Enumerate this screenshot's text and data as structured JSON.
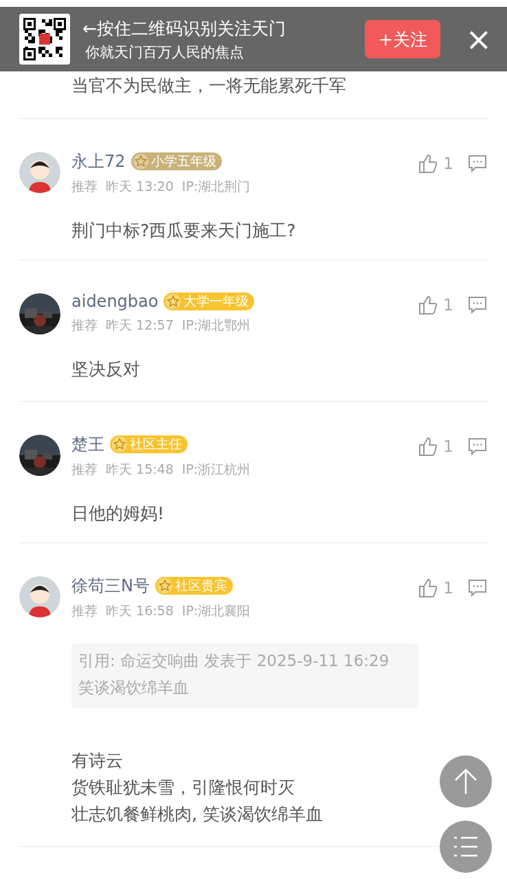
{
  "banner": {
    "title": "←按住二维码识别关注天门",
    "subtitle": "你就天门百万人民的焦点",
    "follow_label": "+关注",
    "close_label": "×"
  },
  "comments": [
    {
      "kind": "partial",
      "body": "当官不为民做主，一将无能累死千军"
    },
    {
      "kind": "full",
      "avatar": {
        "kind": "cartoon"
      },
      "name": "永上72",
      "badge": "小学五年级",
      "color": "#c9b27a",
      "source": "推荐",
      "time": "昨天 13:20",
      "ip": "IP:湖北荆门",
      "likes": "1",
      "body": "荆门中标?西瓜要来天门施工?"
    },
    {
      "kind": "full",
      "name": "aidengbao",
      "badge": "大学一年级",
      "color": "#f7c430",
      "source": "推荐",
      "time": "昨天 12:57",
      "ip": "IP:湖北鄂州",
      "likes": "1",
      "body": "坚决反对"
    },
    {
      "kind": "full",
      "name": "楚王",
      "badge": "社区主任",
      "color": "#f7c430",
      "source": "推荐",
      "time": "昨天 15:48",
      "ip": "IP:浙江杭州",
      "likes": "1",
      "body": "日他的姆妈!"
    },
    {
      "kind": "full",
      "avatar": {
        "kind": "cartoon"
      },
      "name": "徐苟三N号",
      "badge": "社区贵宾",
      "color": "#f7c430",
      "source": "推荐",
      "time": "昨天 16:58",
      "ip": "IP:湖北襄阳",
      "likes": "1",
      "quote": {
        "header": "引用: 命运交响曲 发表于 2025-9-11 16:29",
        "text": "笑谈渴饮绵羊血"
      },
      "body_lines": [
        "有诗云",
        "货铁耻犹未雪，引隆恨何时灭",
        "壮志饥餐鲜桃肉, 笑谈渴饮绵羊血"
      ]
    }
  ]
}
